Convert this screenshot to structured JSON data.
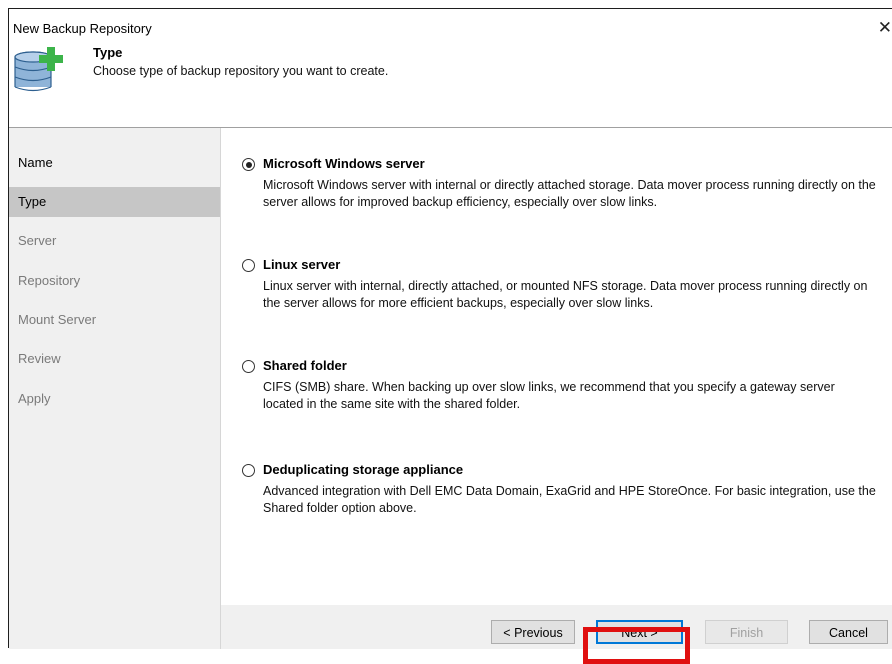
{
  "window": {
    "title": "New Backup Repository",
    "close_glyph": "✕"
  },
  "header": {
    "icon": "database-add-icon",
    "title": "Type",
    "subtitle": "Choose type of backup repository you want to create."
  },
  "steps": [
    {
      "label": "Name",
      "state": "done"
    },
    {
      "label": "Type",
      "state": "active"
    },
    {
      "label": "Server",
      "state": "pending"
    },
    {
      "label": "Repository",
      "state": "pending"
    },
    {
      "label": "Mount Server",
      "state": "pending"
    },
    {
      "label": "Review",
      "state": "pending"
    },
    {
      "label": "Apply",
      "state": "pending"
    }
  ],
  "options": [
    {
      "title": "Microsoft Windows server",
      "description": "Microsoft Windows server with internal or directly attached storage. Data mover process running directly on the server allows for improved backup efficiency, especially over slow links.",
      "selected": true
    },
    {
      "title": "Linux server",
      "description": "Linux server with internal, directly attached, or mounted NFS storage. Data mover process running directly on the server allows for more efficient backups, especially over slow links.",
      "selected": false
    },
    {
      "title": "Shared folder",
      "description": "CIFS (SMB) share. When backing up over slow links, we recommend that you specify a gateway server located in the same site with the shared folder.",
      "selected": false
    },
    {
      "title": "Deduplicating storage appliance",
      "description": "Advanced integration with Dell EMC Data Domain, ExaGrid and HPE StoreOnce. For basic integration, use the Shared folder option above.",
      "selected": false
    }
  ],
  "buttons": {
    "previous": "< Previous",
    "next": "Next >",
    "finish": "Finish",
    "cancel": "Cancel"
  },
  "colors": {
    "highlight": "#e01010",
    "accent_green": "#3cb44a",
    "db_blue": "#8fb4d8"
  }
}
